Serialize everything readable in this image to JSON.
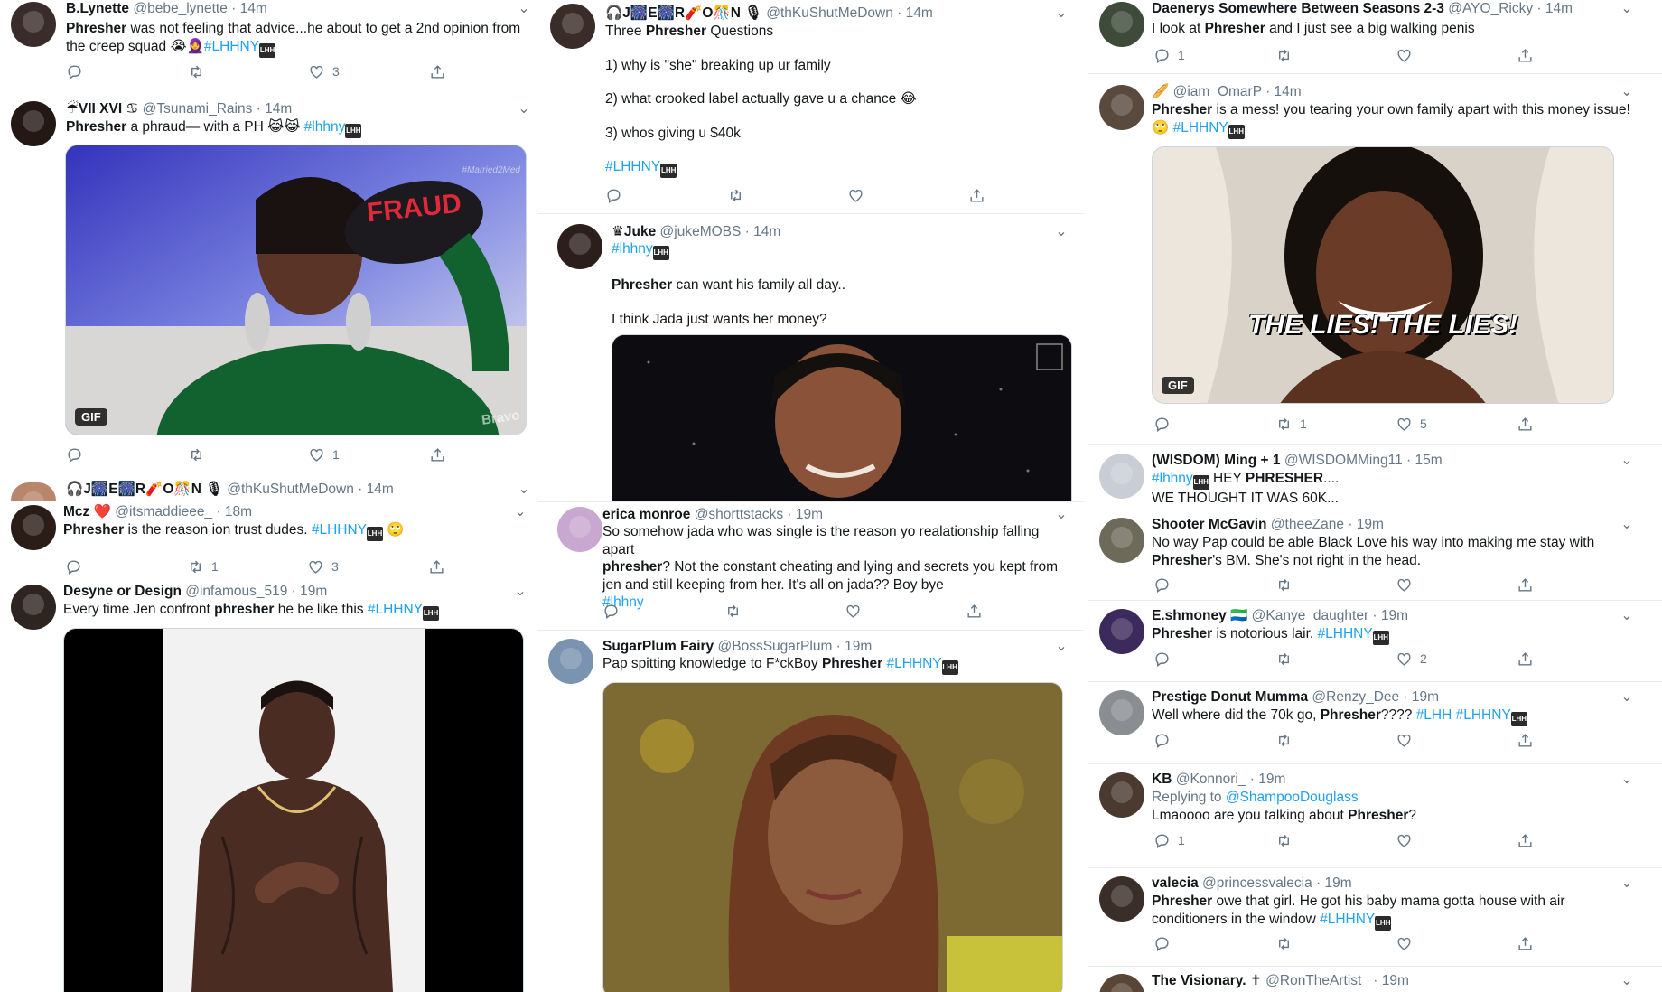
{
  "colors": {
    "link": "#1da1f2",
    "muted": "#657786",
    "separator": "#e6ecf0"
  },
  "icons": {
    "reply": "reply-icon",
    "retweet": "retweet-icon",
    "like": "heart-icon",
    "share": "share-icon",
    "more": "chevron-down-icon"
  },
  "col1": {
    "t1": {
      "name": "B.Lynette",
      "handle": "@bebe_lynette · 14m",
      "pre": "Phresher",
      "body": " was not feeling that advice...he about to get a 2nd opinion from the creep squad 😭🧕",
      "tag": "#LHHNY",
      "likes": "3"
    },
    "t2": {
      "name": "☔VII XVI ♋",
      "handle": "@Tsunami_Rains · 14m",
      "pre": "Phresher",
      "body": " a phraud— with a PH 😹😹 ",
      "tag": "#lhhny",
      "media_text": "FRAUD",
      "watermark": "#Married2Med",
      "corner": "Bravo",
      "gif": "GIF",
      "likes": "1"
    },
    "t3": {
      "name": "🎧J🎆E🎆R🧨O🎊N 🎙",
      "handle": "@thKuShutMeDown · 14m"
    },
    "t4": {
      "name": "Mcz ❤️",
      "handle": "@itsmaddieee_ · 18m",
      "pre": "Phresher",
      "body": " is the reason ion trust dudes. ",
      "tag": "#LHHNY",
      "emoji": " 🙄",
      "retweets": "1",
      "likes": "3"
    },
    "t5": {
      "name": "Desyne or Design",
      "handle": "@infamous_519 · 19m",
      "body": "Every time Jen confront ",
      "pre": "phresher",
      "body2": " he be like this  ",
      "tag": "#LHHNY"
    }
  },
  "col2": {
    "t1": {
      "name": "🎧J🎆E🎆R🧨O🎊N 🎙",
      "handle": "@thKuShutMeDown · 14m",
      "line0a": "Three ",
      "pre": "Phresher",
      "line0b": " Questions",
      "q1": "1) why is \"she\" breaking up ur family",
      "q2": "2) what crooked label actually gave u a chance 😂",
      "q3": "3) whos giving u $40k",
      "tag": "#LHHNY"
    },
    "t2": {
      "name": "♛Juke",
      "handle": "@jukeMOBS · 14m",
      "tag": "#lhhny",
      "pre": "Phresher",
      "line1": " can want his family all day..",
      "line2": "I think Jada just wants her money?"
    },
    "t3": {
      "name": "erica monroe",
      "handle": "@shorttstacks · 19m",
      "line1": "So somehow jada who was single is the reason yo  realationship falling apart",
      "pre": "phresher",
      "line2": "? Not the constant cheating and lying and secrets you kept from jen and still keeping from her. It's all on jada?? Boy bye",
      "tag": "#lhhny"
    },
    "t4": {
      "name": "SugarPlum Fairy",
      "handle": "@BossSugarPlum · 19m",
      "body": "Pap spitting knowledge to F*ckBoy ",
      "pre": "Phresher",
      "tag": " #LHHNY"
    }
  },
  "col3": {
    "t1": {
      "name": "Daenerys Somewhere Between Seasons 2-3",
      "handle": "@AYO_Ricky · 14m",
      "body": "I look at ",
      "pre": "Phresher",
      "body2": " and I just see a big walking penis",
      "replies": "1"
    },
    "t2": {
      "name": "🥖",
      "handle": "@iam_OmarP · 14m",
      "pre": "Phresher",
      "body": " is a mess! you tearing your own family apart with this money issue! 🙄 ",
      "tag": "#LHHNY",
      "media_text": "THE LIES! THE LIES!",
      "gif": "GIF",
      "retweets": "1",
      "likes": "5"
    },
    "t3": {
      "name": "(WISDOM) Ming + 1",
      "handle": "@WISDOMMing11 · 15m",
      "tag": "#lhhny",
      "body": " HEY ",
      "pre": "PHRESHER",
      "body2": "....",
      "line2": "WE THOUGHT IT WAS 60K..."
    },
    "t4": {
      "name": "Shooter McGavin",
      "handle": "@theeZane · 19m",
      "line1": "No way Pap could be able Black Love his way into making me stay with",
      "pre": "Phresher",
      "line2": "'s BM. She's not right in the head."
    },
    "t5": {
      "name": "E.shmoney 🇸🇱",
      "handle": "@Kanye_daughter · 19m",
      "pre": "Phresher",
      "body": " is notorious lair.  ",
      "tag": "#LHHNY",
      "likes": "2"
    },
    "t6": {
      "name": "Prestige Donut Mumma",
      "handle": "@Renzy_Dee · 19m",
      "body": "Well where did the 70k go, ",
      "pre": "Phresher",
      "body2": "???? ",
      "tag": "#LHH #LHHNY"
    },
    "t7": {
      "name": "KB",
      "handle": "@Konnori_ · 19m",
      "replying": "Replying to ",
      "replying_to": "@ShampooDouglass",
      "body": "Lmaoooo are you talking about ",
      "pre": "Phresher",
      "body2": "?",
      "replies": "1"
    },
    "t8": {
      "name": "valecia",
      "handle": "@princessvalecia · 19m",
      "pre": "Phresher",
      "line1": " owe that girl. He got his baby mama gotta house with air",
      "line2": "conditioners in the window ",
      "tag": "#LHHNY"
    },
    "t9": {
      "name": "The Visionary. ✝",
      "handle": "@RonTheArtist_ · 19m"
    }
  }
}
